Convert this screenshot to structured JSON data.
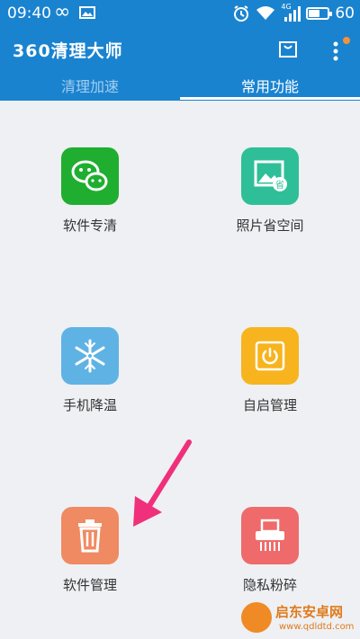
{
  "status_bar": {
    "time": "09:40",
    "network_label": "4G",
    "battery_text": "60",
    "battery_level": 0.6
  },
  "header": {
    "title": "360清理大师",
    "notification_dot_color": "#f39238"
  },
  "tabs": [
    {
      "label": "清理加速",
      "active": false
    },
    {
      "label": "常用功能",
      "active": true
    }
  ],
  "tiles": [
    {
      "label": "软件专清",
      "icon": "wechat-icon",
      "color": "#1fae2f"
    },
    {
      "label": "照片省空间",
      "icon": "photo-saver-icon",
      "color": "#2fbf98"
    },
    {
      "label": "手机降温",
      "icon": "snowflake-icon",
      "color": "#5fb3e4"
    },
    {
      "label": "自启管理",
      "icon": "power-icon",
      "color": "#f7b41e"
    },
    {
      "label": "软件管理",
      "icon": "trash-icon",
      "color": "#f08a62"
    },
    {
      "label": "隐私粉碎",
      "icon": "shredder-icon",
      "color": "#ef6a6a"
    }
  ],
  "annotation": {
    "arrow_color": "#f0307a"
  },
  "watermark": {
    "text": "启东安卓网",
    "url": "www.qdldtd.com"
  }
}
